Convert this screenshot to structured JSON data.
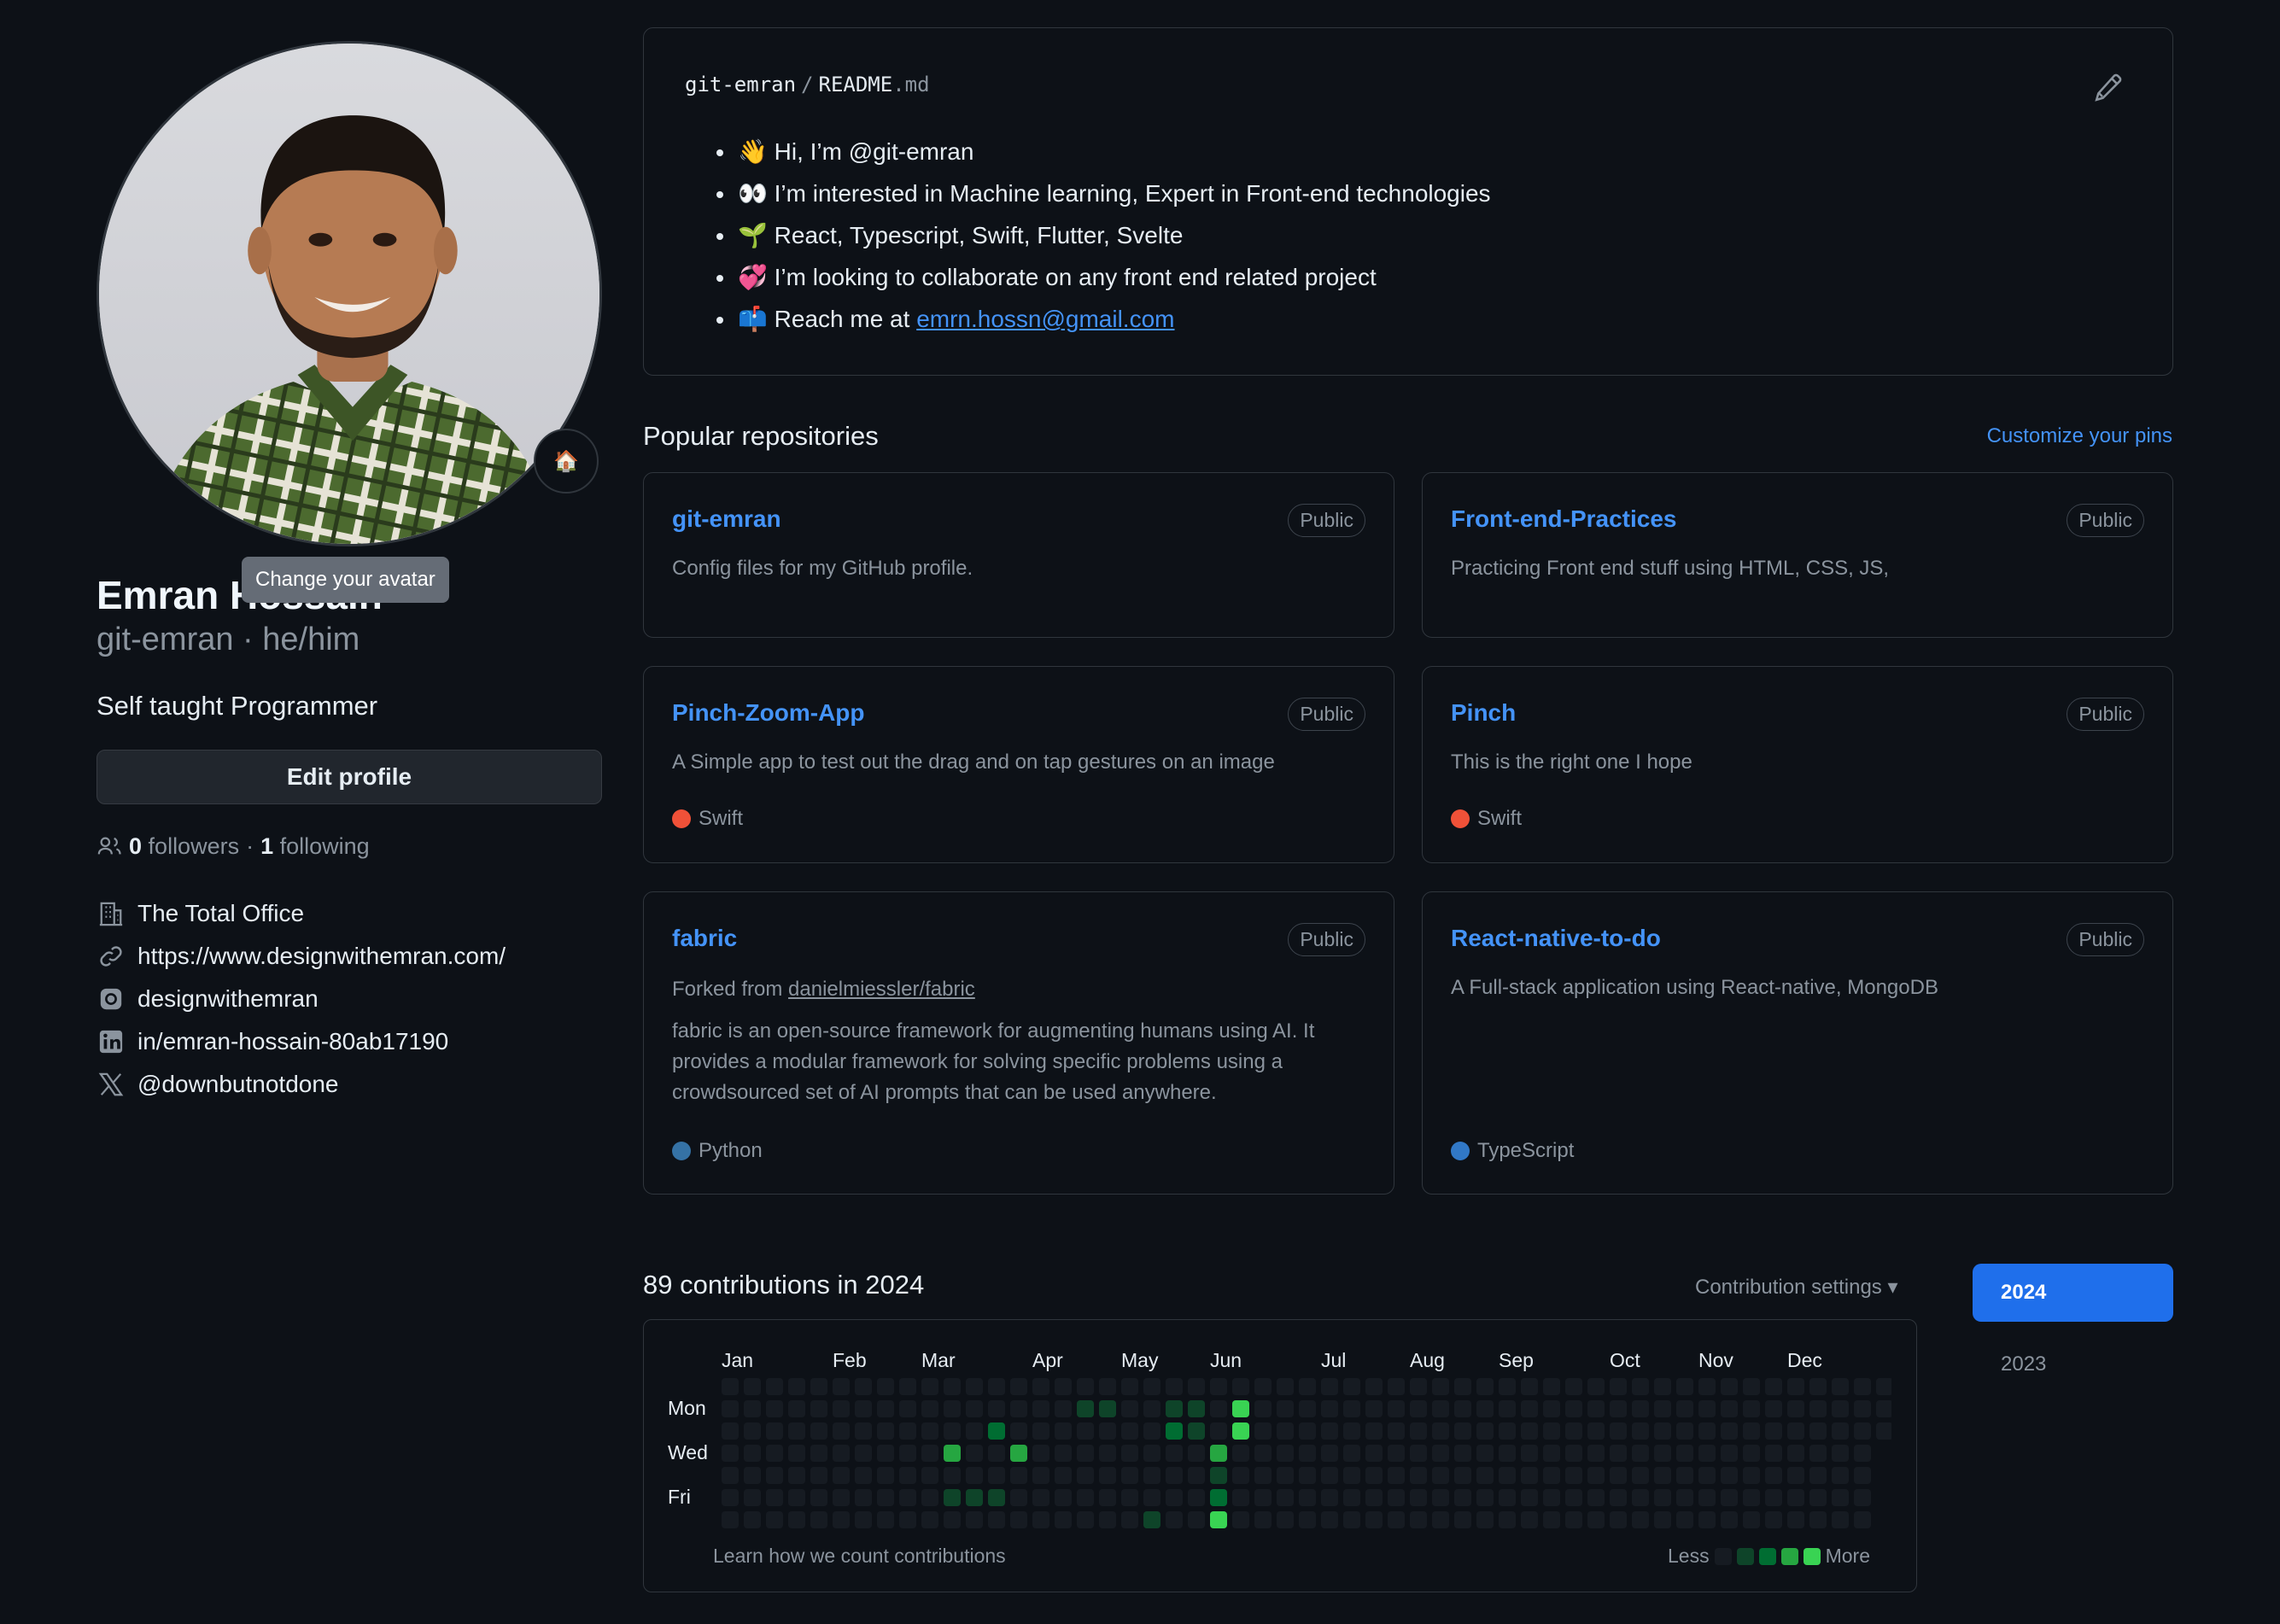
{
  "profile": {
    "full_name": "Emran Hossain",
    "handle": "git-emran · he/him",
    "bio": "Self taught Programmer",
    "status_emoji": "🏠",
    "avatar_tooltip": "Change your avatar",
    "edit_profile_label": "Edit profile",
    "followers_count": "0",
    "followers_label": "followers",
    "following_count": "1",
    "following_label": "following",
    "separator": "·",
    "details": {
      "company": "The Total Office",
      "website": "https://www.designwithemran.com/",
      "instagram": "designwithemran",
      "linkedin": "in/emran-hossain-80ab17190",
      "twitter": "@downbutnotdone"
    }
  },
  "readme": {
    "owner": "git-emran",
    "separator": "/",
    "file": "README",
    "ext": ".md",
    "lines": [
      {
        "emoji": "👋",
        "text": "Hi, I’m @git-emran"
      },
      {
        "emoji": "👀",
        "text": "I’m interested in Machine learning, Expert in Front-end technologies"
      },
      {
        "emoji": "🌱",
        "text": "React, Typescript, Swift, Flutter, Svelte"
      },
      {
        "emoji": "💞️",
        "text": "I’m looking to collaborate on any front end related project"
      },
      {
        "emoji": "📫",
        "text": "Reach me at",
        "link": "emrn.hossn@gmail.com"
      }
    ]
  },
  "popular": {
    "title": "Popular repositories",
    "customize_label": "Customize your pins",
    "repos": [
      {
        "name": "git-emran",
        "visibility": "Public",
        "description": "Config files for my GitHub profile.",
        "language": "",
        "lang_color": ""
      },
      {
        "name": "Front-end-Practices",
        "visibility": "Public",
        "description": "Practicing Front end stuff using HTML, CSS, JS,",
        "language": "",
        "lang_color": ""
      },
      {
        "name": "Pinch-Zoom-App",
        "visibility": "Public",
        "description": "A Simple app to test out the drag and on tap gestures on an image",
        "language": "Swift",
        "lang_color": "#F05138"
      },
      {
        "name": "Pinch",
        "visibility": "Public",
        "description": "This is the right one I hope",
        "language": "Swift",
        "lang_color": "#F05138"
      },
      {
        "name": "fabric",
        "visibility": "Public",
        "forked_prefix": "Forked from",
        "forked_from": "danielmiessler/fabric",
        "description": "fabric is an open-source framework for augmenting humans using AI. It provides a modular framework for solving specific problems using a crowdsourced set of AI prompts that can be used anywhere.",
        "language": "Python",
        "lang_color": "#3572A5"
      },
      {
        "name": "React-native-to-do",
        "visibility": "Public",
        "description": "A Full-stack application using React-native, MongoDB",
        "language": "TypeScript",
        "lang_color": "#3178C6"
      }
    ]
  },
  "contributions": {
    "title": "89 contributions in 2024",
    "settings_label": "Contribution settings ▾",
    "months": [
      "Jan",
      "Feb",
      "Mar",
      "Apr",
      "May",
      "Jun",
      "Jul",
      "Aug",
      "Sep",
      "Oct",
      "Nov",
      "Dec"
    ],
    "days": [
      "Mon",
      "Wed",
      "Fri"
    ],
    "learn_label": "Learn how we count contributions",
    "legend_less": "Less",
    "legend_more": "More",
    "level_colors": [
      "#161b22",
      "#0e4429",
      "#006d32",
      "#26a641",
      "#39d353"
    ],
    "weeks": 53,
    "cells": [
      {
        "week": 12,
        "day": 2,
        "level": 2
      },
      {
        "week": 10,
        "day": 3,
        "level": 3
      },
      {
        "week": 13,
        "day": 3,
        "level": 3
      },
      {
        "week": 10,
        "day": 5,
        "level": 1
      },
      {
        "week": 11,
        "day": 5,
        "level": 1
      },
      {
        "week": 12,
        "day": 5,
        "level": 1
      },
      {
        "week": 12,
        "day": 7,
        "level": 4
      },
      {
        "week": 16,
        "day": 1,
        "level": 1
      },
      {
        "week": 17,
        "day": 1,
        "level": 1
      },
      {
        "week": 20,
        "day": 1,
        "level": 1
      },
      {
        "week": 21,
        "day": 1,
        "level": 1
      },
      {
        "week": 20,
        "day": 2,
        "level": 2
      },
      {
        "week": 21,
        "day": 2,
        "level": 1
      },
      {
        "week": 19,
        "day": 6,
        "level": 1
      },
      {
        "week": 19,
        "day": 7,
        "level": 4
      },
      {
        "week": 23,
        "day": 1,
        "level": 4
      },
      {
        "week": 23,
        "day": 2,
        "level": 4
      },
      {
        "week": 22,
        "day": 3,
        "level": 3
      },
      {
        "week": 22,
        "day": 4,
        "level": 1
      },
      {
        "week": 22,
        "day": 5,
        "level": 2
      },
      {
        "week": 22,
        "day": 6,
        "level": 4
      },
      {
        "week": 21,
        "day": 7,
        "level": 1
      },
      {
        "week": 22,
        "day": 7,
        "level": 4
      }
    ],
    "years": [
      "2024",
      "2023"
    ]
  }
}
